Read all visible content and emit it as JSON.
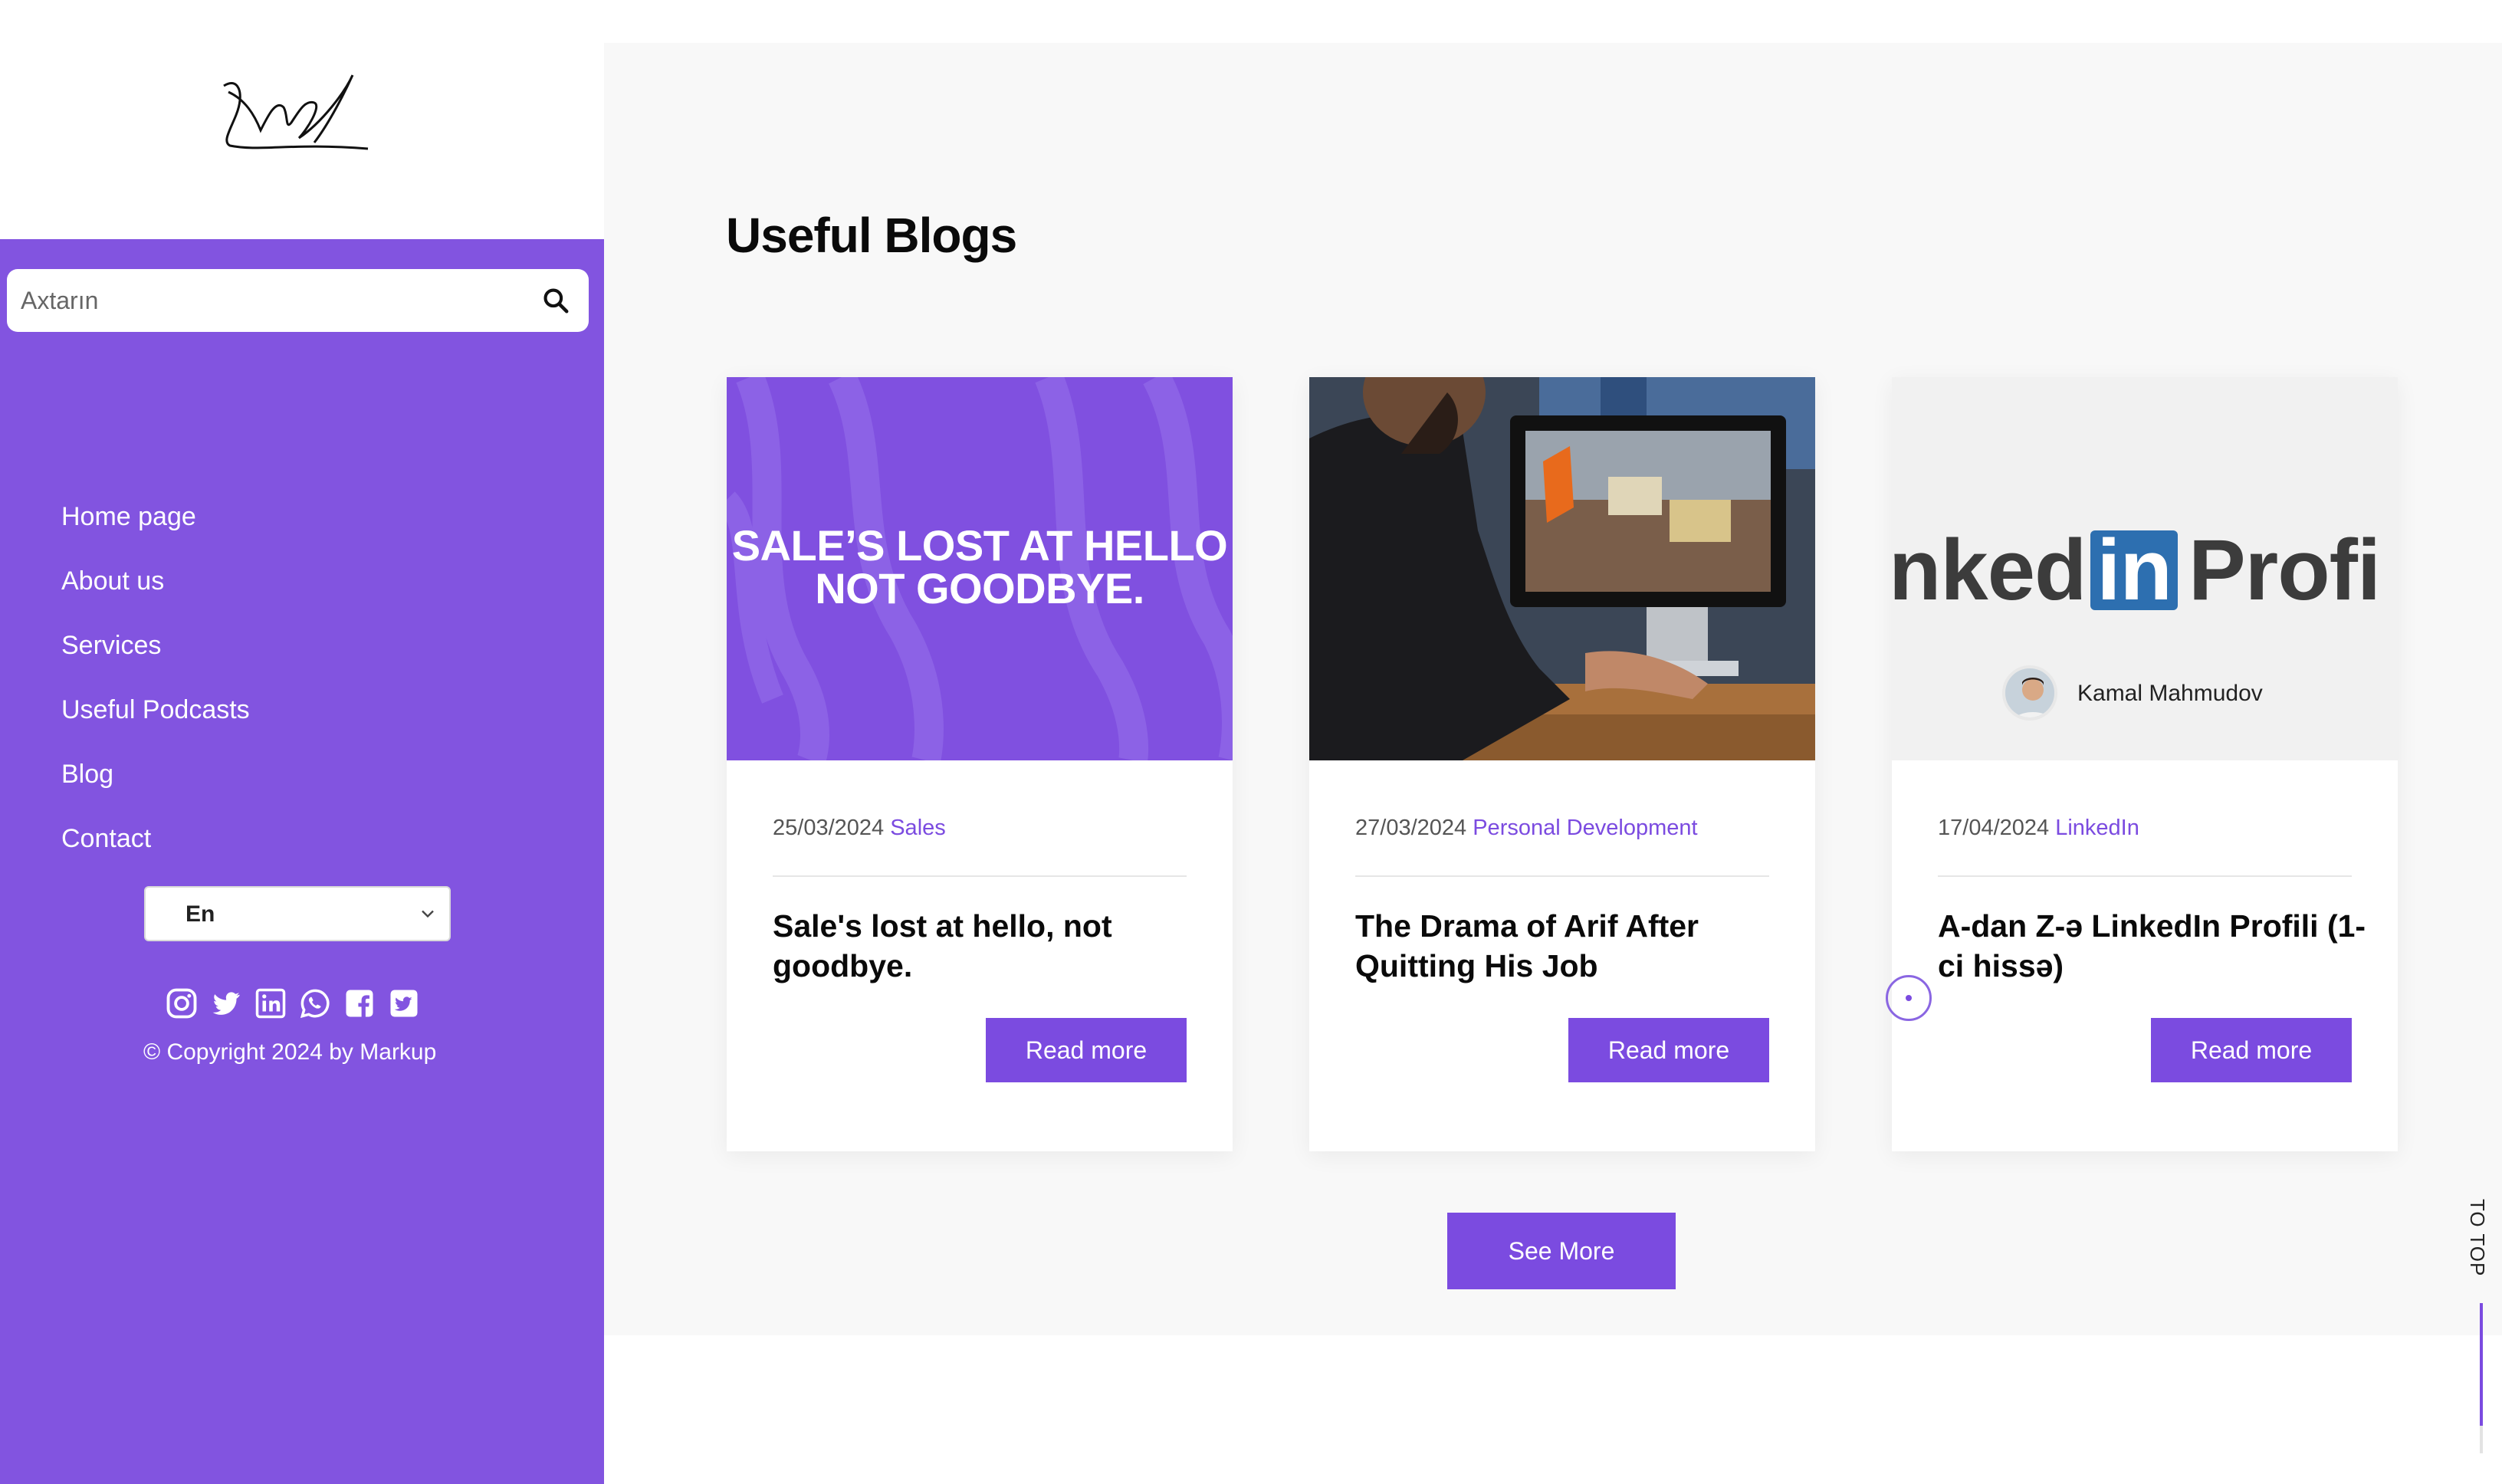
{
  "search": {
    "placeholder": "Axtarın"
  },
  "nav": {
    "items": [
      {
        "label": "Home page"
      },
      {
        "label": "About us"
      },
      {
        "label": "Services"
      },
      {
        "label": "Useful Podcasts"
      },
      {
        "label": "Blog"
      },
      {
        "label": "Contact"
      }
    ]
  },
  "language": {
    "selected": "En"
  },
  "social_icons": [
    "instagram-icon",
    "twitter-icon",
    "linkedin-icon",
    "whatsapp-icon",
    "facebook-icon",
    "twitter-square-icon"
  ],
  "footer": {
    "copyright": "© Copyright 2024 by ",
    "brand": "Markup"
  },
  "main": {
    "title": "Useful Blogs",
    "see_more": "See More"
  },
  "cards": [
    {
      "date": "25/03/2024",
      "category": "Sales",
      "title": "Sale's lost at hello, not goodbye.",
      "button": "Read more",
      "image_text_line1": "SALE’S LOST AT HELLO",
      "image_text_line2": "NOT GOODBYE."
    },
    {
      "date": "27/03/2024",
      "category": "Personal Development",
      "title": "The Drama of Arif After Quitting His Job",
      "button": "Read more"
    },
    {
      "date": "17/04/2024",
      "category": "LinkedIn",
      "title": "A-dan Z-ə LinkedIn Profili (1-ci hissə)",
      "button": "Read more",
      "image_text_left": "nked",
      "image_text_badge": "in",
      "image_text_right": "Profi",
      "image_author": "Kamal Mahmudov"
    }
  ],
  "to_top": "TO TOP",
  "colors": {
    "accent": "#7B4BE0",
    "sidebar": "#8254E0"
  }
}
